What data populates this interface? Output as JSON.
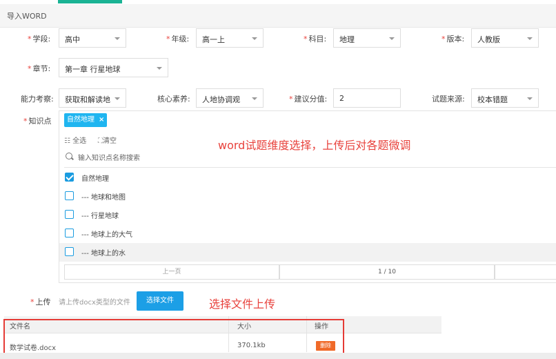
{
  "window": {
    "title": "导入WORD"
  },
  "form": {
    "school_level": {
      "label": "学段:",
      "value": "高中"
    },
    "grade": {
      "label": "年级:",
      "value": "高一上"
    },
    "subject": {
      "label": "科目:",
      "value": "地理"
    },
    "edition": {
      "label": "版本:",
      "value": "人教版"
    },
    "chapter": {
      "label": "章节:",
      "value": "第一章 行星地球"
    },
    "ability": {
      "label": "能力考察:",
      "value": "获取和解读地"
    },
    "core_literacy": {
      "label": "核心素养:",
      "value": "人地协调观"
    },
    "score": {
      "label": "建议分值:",
      "value": "2"
    },
    "source": {
      "label": "试题来源:",
      "value": "校本错题"
    },
    "required_mark": "*"
  },
  "knowledge": {
    "label": "知识点",
    "selected_tag": "自然地理",
    "tag_close": "×",
    "select_all": "全选",
    "clear": "清空",
    "search_placeholder": "输入知识点名称搜索",
    "options": [
      {
        "label": "自然地理",
        "checked": true
      },
      {
        "label": "--- 地球和地图",
        "checked": false
      },
      {
        "label": "--- 行星地球",
        "checked": false
      },
      {
        "label": "--- 地球上的大气",
        "checked": false
      },
      {
        "label": "--- 地球上的水",
        "checked": false
      }
    ],
    "pager": {
      "prev": "上一页",
      "page": "1 / 10"
    }
  },
  "annotations": {
    "dimension": "word试题维度选择，上传后对各题微调",
    "upload": "选择文件上传"
  },
  "upload": {
    "label": "上传",
    "hint": "请上传docx类型的文件",
    "button": "选择文件"
  },
  "file_table": {
    "headers": [
      "文件名",
      "大小",
      "操作"
    ],
    "rows": [
      {
        "name": "数学试卷.docx",
        "size": "370.1kb",
        "action": "删除"
      }
    ]
  },
  "colors": {
    "accent": "#1ab394",
    "primary": "#1c9fe6",
    "required": "#e8423c",
    "delete": "#f06a29"
  }
}
